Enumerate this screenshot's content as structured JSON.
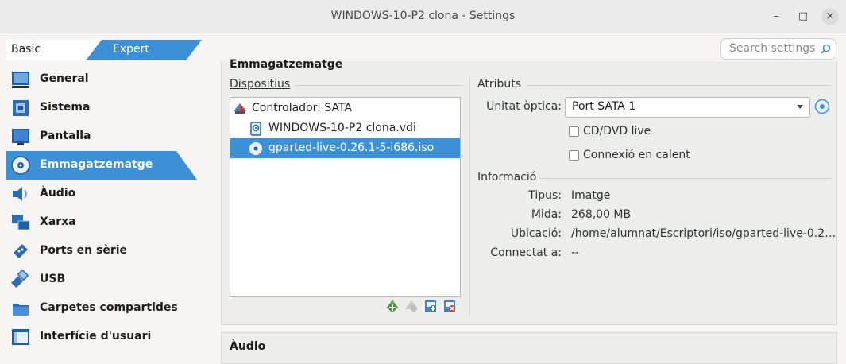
{
  "window": {
    "title": "WINDOWS-10-P2 clona - Settings",
    "controls": {
      "minimize": "–",
      "maximize": "□",
      "close": "×"
    }
  },
  "mode": {
    "basic": "Basic",
    "expert": "Expert",
    "active": "Expert"
  },
  "search": {
    "placeholder": "Search settings"
  },
  "sidebar": {
    "items": [
      {
        "label": "General",
        "icon": "general-icon"
      },
      {
        "label": "Sistema",
        "icon": "system-icon"
      },
      {
        "label": "Pantalla",
        "icon": "display-icon"
      },
      {
        "label": "Emmagatzematge",
        "icon": "storage-icon",
        "active": true
      },
      {
        "label": "Àudio",
        "icon": "audio-icon"
      },
      {
        "label": "Xarxa",
        "icon": "network-icon"
      },
      {
        "label": "Ports en sèrie",
        "icon": "serial-ports-icon"
      },
      {
        "label": "USB",
        "icon": "usb-icon"
      },
      {
        "label": "Carpetes compartides",
        "icon": "shared-folders-icon"
      },
      {
        "label": "Interfície d'usuari",
        "icon": "user-interface-icon"
      }
    ]
  },
  "storage": {
    "heading": "Emmagatzematge",
    "devices_title": "Dispositius",
    "tree": [
      {
        "label": "Controlador: SATA",
        "icon": "controller-icon"
      },
      {
        "label": "WINDOWS-10-P2 clona.vdi",
        "icon": "hard-disk-icon"
      },
      {
        "label": "gparted-live-0.26.1-5-i686.iso",
        "icon": "optical-disc-icon",
        "selected": true
      }
    ],
    "attributes": {
      "title": "Atributs",
      "optical_drive_label": "Unitat òptica:",
      "optical_drive_value": "Port SATA 1",
      "live_cd_label": "CD/DVD live",
      "live_cd_checked": false,
      "hot_plug_label": "Connexió en calent",
      "hot_plug_checked": false
    },
    "information": {
      "title": "Informació",
      "rows": [
        {
          "label": "Tipus:",
          "value": "Imatge"
        },
        {
          "label": "Mida:",
          "value": "268,00 MB"
        },
        {
          "label": "Ubicació:",
          "value": "/home/alumnat/Escriptori/iso/gparted-live-0.2…"
        },
        {
          "label": "Connectat a:",
          "value": "--"
        }
      ]
    }
  },
  "audio_section": {
    "heading": "Àudio"
  },
  "colors": {
    "accent": "#3d8fd6",
    "panel": "#ededeb",
    "background": "#f6f5f4"
  }
}
